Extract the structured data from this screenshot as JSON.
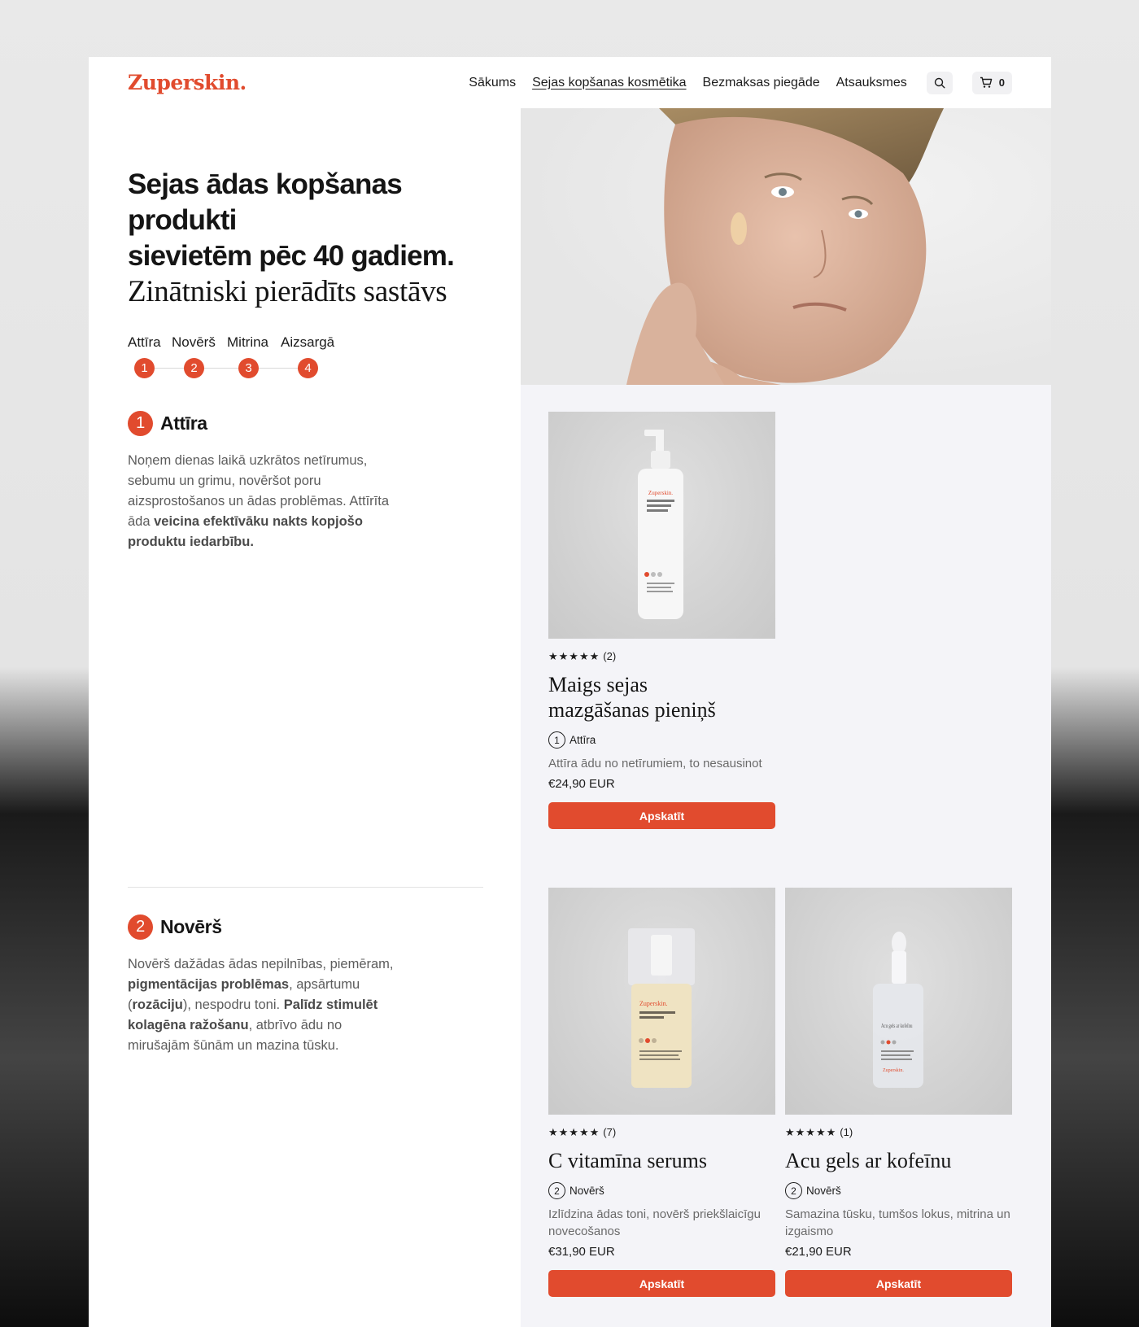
{
  "brand": {
    "logo": "Zuperskin.",
    "accent": "#e14b2e"
  },
  "nav": {
    "items": [
      "Sākums",
      "Sejas kopšanas kosmētika",
      "Bezmaksas piegāde",
      "Atsauksmes"
    ],
    "active_index": 1,
    "cart_count": "0"
  },
  "hero": {
    "title_line1": "Sejas ādas kopšanas produkti",
    "title_line2": "sievietēm pēc 40 gadiem.",
    "subtitle": "Zinātniski pierādīts sastāvs"
  },
  "steps": [
    {
      "label": "Attīra",
      "num": "1"
    },
    {
      "label": "Novērš",
      "num": "2"
    },
    {
      "label": "Mitrina",
      "num": "3"
    },
    {
      "label": "Aizsargā",
      "num": "4"
    }
  ],
  "sections": [
    {
      "num": "1",
      "title": "Attīra",
      "text_plain": "Noņem dienas laikā uzkrātos netīrumus, sebumu un grimu, novēršot poru aizsprostošanos un ādas problēmas. Attīrīta āda ",
      "text_bold": "veicina efektīvāku nakts kopjošo produktu iedarbību."
    },
    {
      "num": "2",
      "title": "Novērš",
      "p1": "Novērš dažādas ādas nepilnības, piemēram, ",
      "b1": "pigmentācijas problēmas",
      "p2": ", apsārtumu (",
      "b2": "rozāciju",
      "p3": "), nespodru toni. ",
      "b3": "Palīdz stimulēt kolagēna ražošanu",
      "p4": ", atbrīvo ādu no mirušajām šūnām un mazina tūsku."
    }
  ],
  "products": [
    {
      "stars": "★★★★★",
      "reviews": "(2)",
      "title": "Maigs sejas mazgāšanas pieniņš",
      "tag_num": "1",
      "tag": "Attīra",
      "desc": "Attīra ādu no netīrumiem, to nesausinot",
      "price": "€24,90 EUR",
      "button": "Apskatīt",
      "label_brand": "Zuperskin.",
      "label_name": "Maigs sejas mazgāšanas pieniņš"
    },
    {
      "stars": "★★★★★",
      "reviews": "(7)",
      "title": "C vitamīna serums",
      "tag_num": "2",
      "tag": "Novērš",
      "desc": "Izlīdzina ādas toni, novērš priekšlaicīgu novecošanos",
      "price": "€31,90 EUR",
      "button": "Apskatīt",
      "label_brand": "Zuperskin.",
      "label_name": "C vitamīna serums"
    },
    {
      "stars": "★★★★★",
      "reviews": "(1)",
      "title": "Acu gels ar kofeīnu",
      "tag_num": "2",
      "tag": "Novērš",
      "desc": "Samazina tūsku, tumšos lokus, mitrina un izgaismo",
      "price": "€21,90 EUR",
      "button": "Apskatīt",
      "label_brand": "Zuperskin.",
      "label_name": "Acu gels ar kofeīnu"
    }
  ]
}
